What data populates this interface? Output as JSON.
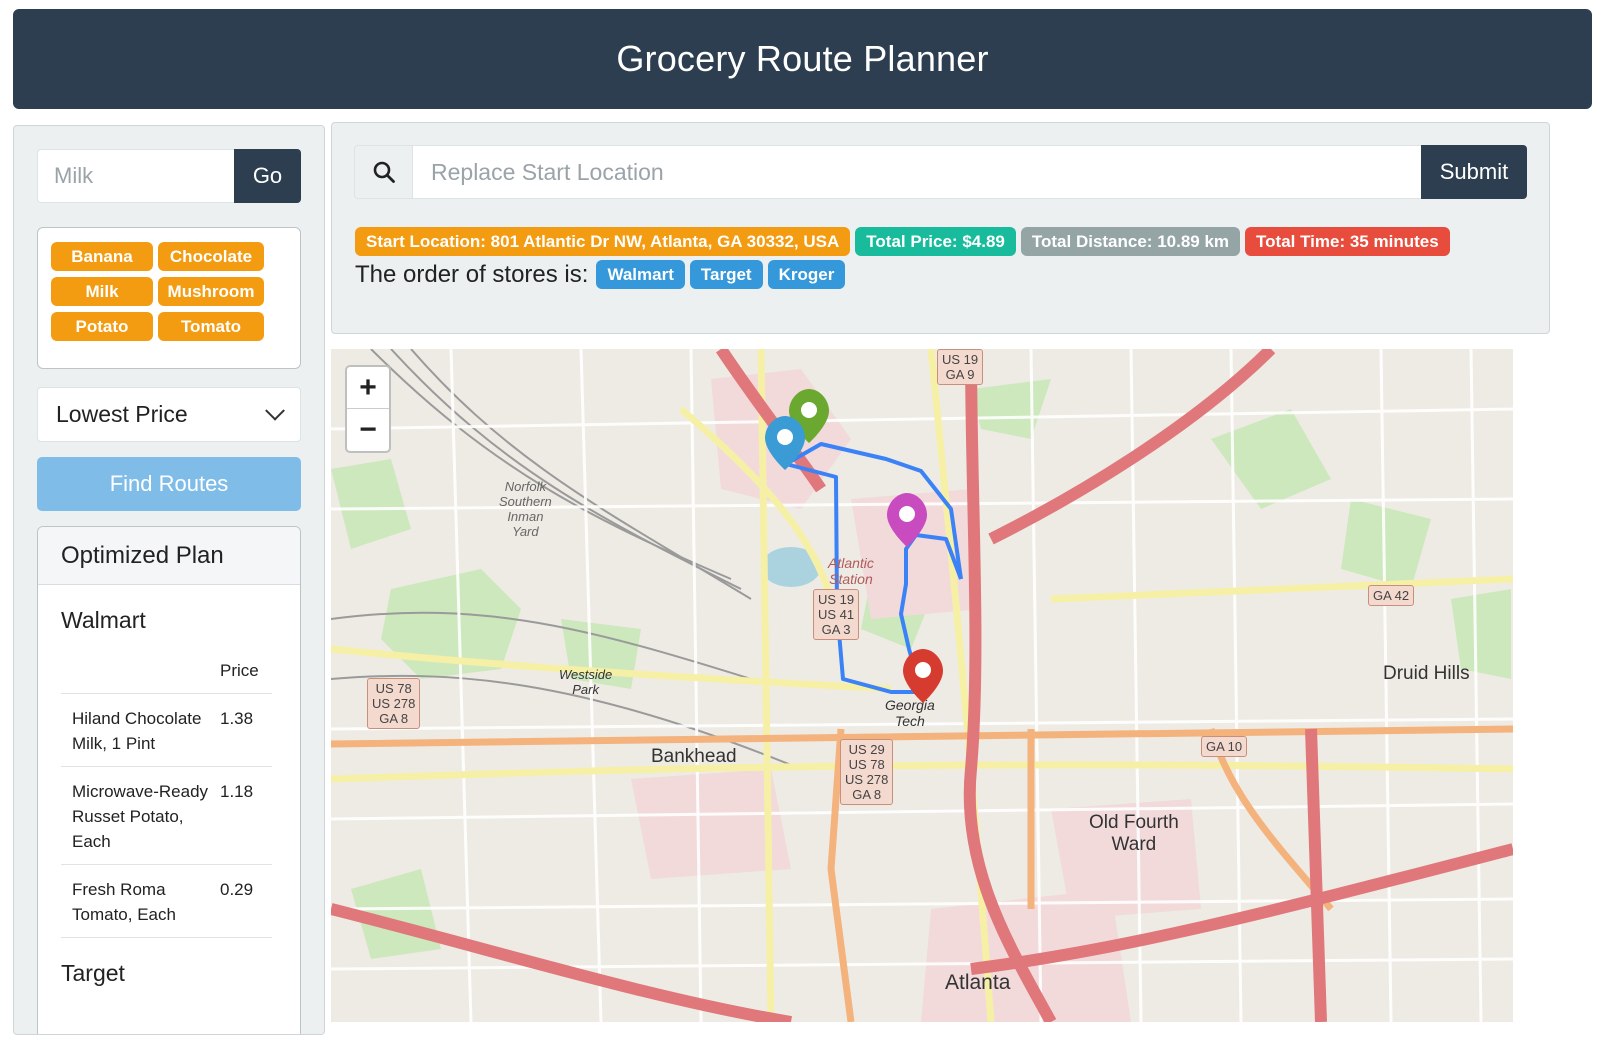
{
  "header": {
    "title": "Grocery Route Planner"
  },
  "sidebar": {
    "search": {
      "placeholder": "Milk",
      "button_label": "Go"
    },
    "items": [
      "Banana",
      "Chocolate",
      "Milk",
      "Mushroom",
      "Potato",
      "Tomato"
    ],
    "sort": {
      "selected": "Lowest Price"
    },
    "find_button_label": "Find Routes",
    "plan": {
      "title": "Optimized Plan",
      "stores": [
        {
          "name": "Walmart",
          "price_header": "Price",
          "rows": [
            {
              "item": "Hiland Chocolate Milk, 1 Pint",
              "price": "1.38"
            },
            {
              "item": "Microwave-Ready Russet Potato, Each",
              "price": "1.18"
            },
            {
              "item": "Fresh Roma Tomato, Each",
              "price": "0.29"
            }
          ]
        },
        {
          "name": "Target"
        }
      ]
    }
  },
  "info": {
    "location_placeholder": "Replace Start Location",
    "submit_label": "Submit",
    "start_location": "Start Location: 801 Atlantic Dr NW, Atlanta, GA 30332, USA",
    "total_price": "Total Price: $4.89",
    "total_distance": "Total Distance: 10.89 km",
    "total_time": "Total Time: 35 minutes",
    "order_label": "The order of stores is:",
    "order": [
      "Walmart",
      "Target",
      "Kroger"
    ]
  },
  "map": {
    "zoom_in": "+",
    "zoom_out": "−",
    "labels": {
      "bankhead": "Bankhead",
      "druid_hills": "Druid Hills",
      "old_fourth_ward": "Old Fourth\nWard",
      "atlanta": "Atlanta",
      "georgia_tech": "Georgia\nTech",
      "westside_park": "Westside\nPark",
      "atlantic_station": "Atlantic\nStation",
      "norfolk": "Norfolk\nSouthern\nInman\nYard"
    },
    "shields": {
      "us19_ga9": "US 19\nGA 9",
      "us78": "US 78\nUS 278\nGA 8",
      "us29": "US 29\nUS 78\nUS 278\nGA 8",
      "us19_41": "US 19\nUS 41\nGA 3",
      "ga42": "GA 42",
      "ga10": "GA 10"
    },
    "marker_colors": {
      "walmart": "#3a9bd5",
      "target": "#c84bbf",
      "kroger": "#d63b2f",
      "start": "#6aa82f"
    },
    "route_color": "#3b82f6"
  }
}
